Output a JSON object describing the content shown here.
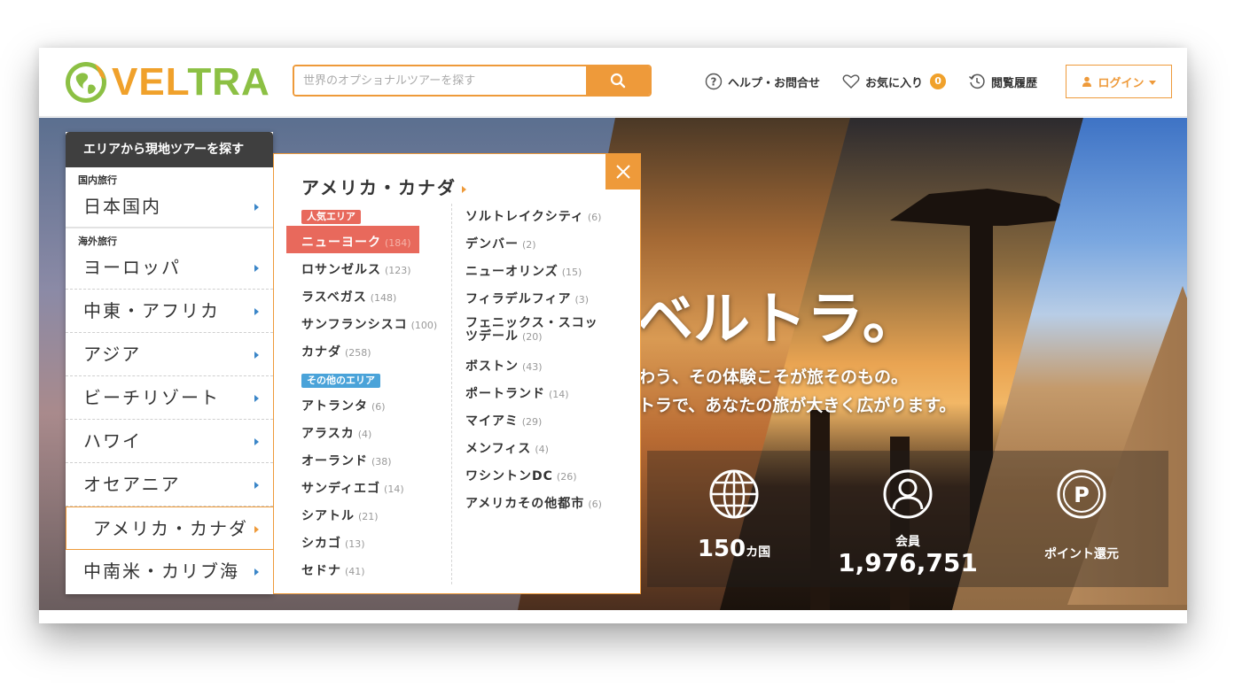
{
  "header": {
    "brand": "VELTRA",
    "search_placeholder": "世界のオプショナルツアーを探す",
    "help_label": "ヘルプ・お問合せ",
    "favorites_label": "お気に入り",
    "favorites_count": "0",
    "history_label": "閲覧履歴",
    "login_label": "ログイン"
  },
  "hero": {
    "title": "ベルトラ。",
    "subtitle_1": "わう、その体験こそが旅そのもの。",
    "subtitle_2": "トラで、あなたの旅が大きく広がります。",
    "stats": [
      {
        "value": "150",
        "unit": "カ国"
      },
      {
        "label": "会員",
        "value": "1,976,751"
      },
      {
        "label": "ポイント還元"
      }
    ]
  },
  "region_panel": {
    "heading": "エリアから現地ツアーを探す",
    "domestic_label": "国内旅行",
    "overseas_label": "海外旅行",
    "items": [
      {
        "label": "日本国内"
      },
      {
        "label": "ヨーロッパ"
      },
      {
        "label": "中東・アフリカ"
      },
      {
        "label": "アジア"
      },
      {
        "label": "ビーチリゾート"
      },
      {
        "label": "ハワイ"
      },
      {
        "label": "オセアニア"
      },
      {
        "label": "アメリカ・カナダ"
      },
      {
        "label": "中南米・カリブ海"
      }
    ]
  },
  "dropdown": {
    "title": "アメリカ・カナダ",
    "popular_tag": "人気エリア",
    "other_tag": "その他のエリア",
    "popular": [
      {
        "name": "ニューヨーク",
        "count": "(184)"
      },
      {
        "name": "ロサンゼルス",
        "count": "(123)"
      },
      {
        "name": "ラスベガス",
        "count": "(148)"
      },
      {
        "name": "サンフランシスコ",
        "count": "(100)"
      },
      {
        "name": "カナダ",
        "count": "(258)"
      }
    ],
    "other": [
      {
        "name": "アトランタ",
        "count": "(6)"
      },
      {
        "name": "アラスカ",
        "count": "(4)"
      },
      {
        "name": "オーランド",
        "count": "(38)"
      },
      {
        "name": "サンディエゴ",
        "count": "(14)"
      },
      {
        "name": "シアトル",
        "count": "(21)"
      },
      {
        "name": "シカゴ",
        "count": "(13)"
      },
      {
        "name": "セドナ",
        "count": "(41)"
      }
    ],
    "right": [
      {
        "name": "ソルトレイクシティ",
        "count": "(6)"
      },
      {
        "name": "デンバー",
        "count": "(2)"
      },
      {
        "name": "ニューオリンズ",
        "count": "(15)"
      },
      {
        "name": "フィラデルフィア",
        "count": "(3)"
      },
      {
        "name": "フェニックス・スコッツデール",
        "count": "(20)"
      },
      {
        "name": "ボストン",
        "count": "(43)"
      },
      {
        "name": "ポートランド",
        "count": "(14)"
      },
      {
        "name": "マイアミ",
        "count": "(29)"
      },
      {
        "name": "メンフィス",
        "count": "(4)"
      },
      {
        "name": "ワシントンDC",
        "count": "(26)"
      },
      {
        "name": "アメリカその他都市",
        "count": "(6)"
      }
    ]
  },
  "colors": {
    "accent": "#ee9a3a",
    "highlight": "#e8695c",
    "popular_tag": "#e8695c",
    "other_tag": "#4aa3d9",
    "arrow": "#3b86c8"
  }
}
